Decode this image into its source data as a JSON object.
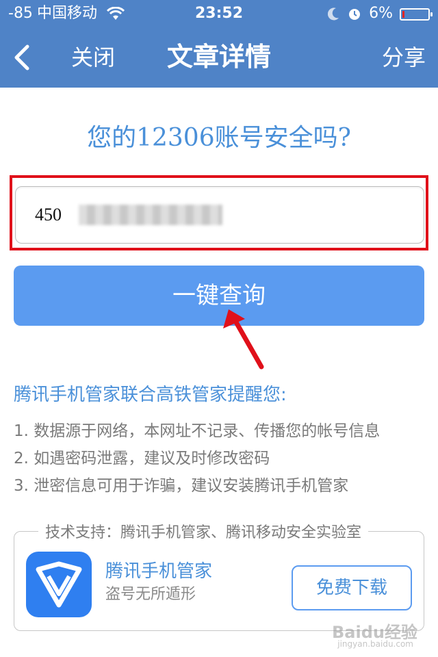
{
  "status_bar": {
    "signal": "-85",
    "carrier": "中国移动",
    "time": "23:52",
    "battery": "6%"
  },
  "nav": {
    "close_label": "关闭",
    "title": "文章详情",
    "share_label": "分享"
  },
  "main": {
    "question": "您的12306账号安全吗?",
    "account_input": {
      "value_prefix": "450"
    },
    "query_button_label": "一键查询",
    "reminder_title": "腾讯手机管家联合高铁管家提醒您:",
    "tips": [
      "1. 数据源于网络，本网址不记录、传播您的帐号信息",
      "2. 如遇密码泄露，建议及时修改密码",
      "3. 泄密信息可用于诈骗，建议安装腾讯手机管家"
    ]
  },
  "support": {
    "legend": "技术支持：腾讯手机管家、腾讯移动安全实验室",
    "app_name": "腾讯手机管家",
    "app_slogan": "盗号无所遁形",
    "download_label": "免费下载"
  },
  "watermark": {
    "text": "Baidu经验",
    "sub": "jingyan.baidu.com"
  },
  "colors": {
    "header_bg": "#4f83c7",
    "accent_blue": "#4a90d9",
    "button_blue": "#5b9bf0",
    "annotation_red": "#e0101a"
  },
  "icons": [
    "wifi-icon",
    "moon-icon",
    "alarm-icon",
    "battery-icon",
    "back-chevron-icon",
    "tencent-shield-icon",
    "annotation-arrow-icon"
  ]
}
